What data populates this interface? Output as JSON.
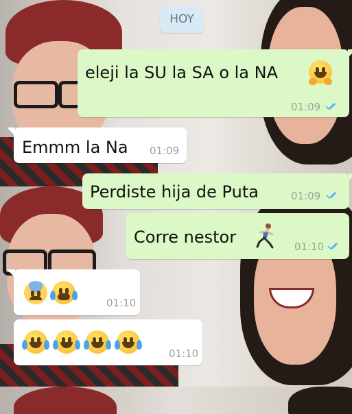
{
  "chat": {
    "day_chip": "HOY",
    "messages": [
      {
        "direction": "outgoing",
        "text": "eleji la SU la SA o la NA",
        "emoji": [
          "smiling-face-with-open-hands"
        ],
        "time": "01:09",
        "status": "read"
      },
      {
        "direction": "incoming",
        "text": "Emmm la Na",
        "time": "01:09"
      },
      {
        "direction": "outgoing",
        "text": "Perdiste hija de Puta",
        "time": "01:09",
        "status": "read"
      },
      {
        "direction": "outgoing",
        "text": "Corre nestor",
        "emoji": [
          "person-running"
        ],
        "time": "01:10",
        "status": "read"
      },
      {
        "direction": "incoming",
        "text": "",
        "emoji": [
          "anxious-face-with-sweat",
          "loudly-crying-face"
        ],
        "time": "01:10"
      },
      {
        "direction": "incoming",
        "text": "",
        "emoji": [
          "face-with-tears-of-joy",
          "face-with-tears-of-joy",
          "face-with-tears-of-joy",
          "face-with-tears-of-joy"
        ],
        "time": "01:10"
      }
    ]
  },
  "colors": {
    "outgoing_bubble": "#dcf8c6",
    "incoming_bubble": "#ffffff",
    "read_ticks": "#4fb6ec",
    "day_chip": "#d9eaf4"
  }
}
